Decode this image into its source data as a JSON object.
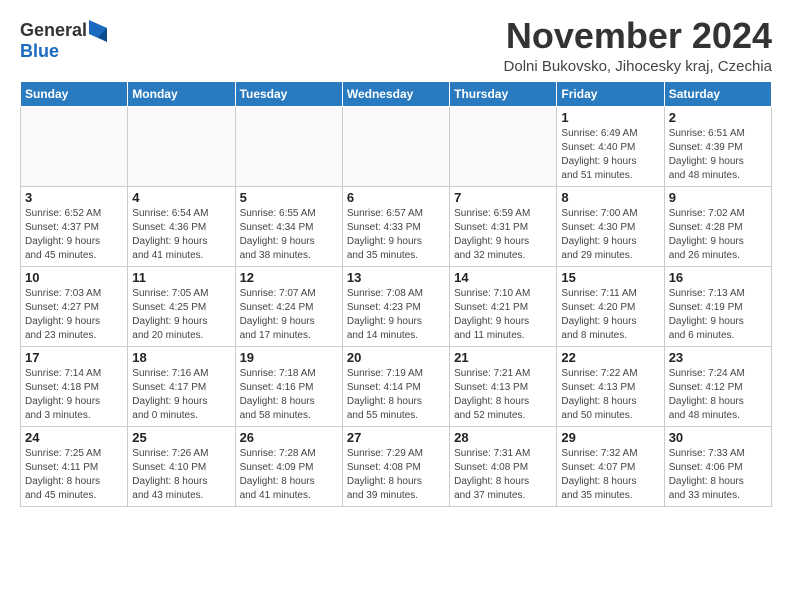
{
  "logo": {
    "general": "General",
    "blue": "Blue"
  },
  "title": "November 2024",
  "location": "Dolni Bukovsko, Jihocesky kraj, Czechia",
  "headers": [
    "Sunday",
    "Monday",
    "Tuesday",
    "Wednesday",
    "Thursday",
    "Friday",
    "Saturday"
  ],
  "weeks": [
    [
      {
        "day": "",
        "info": ""
      },
      {
        "day": "",
        "info": ""
      },
      {
        "day": "",
        "info": ""
      },
      {
        "day": "",
        "info": ""
      },
      {
        "day": "",
        "info": ""
      },
      {
        "day": "1",
        "info": "Sunrise: 6:49 AM\nSunset: 4:40 PM\nDaylight: 9 hours\nand 51 minutes."
      },
      {
        "day": "2",
        "info": "Sunrise: 6:51 AM\nSunset: 4:39 PM\nDaylight: 9 hours\nand 48 minutes."
      }
    ],
    [
      {
        "day": "3",
        "info": "Sunrise: 6:52 AM\nSunset: 4:37 PM\nDaylight: 9 hours\nand 45 minutes."
      },
      {
        "day": "4",
        "info": "Sunrise: 6:54 AM\nSunset: 4:36 PM\nDaylight: 9 hours\nand 41 minutes."
      },
      {
        "day": "5",
        "info": "Sunrise: 6:55 AM\nSunset: 4:34 PM\nDaylight: 9 hours\nand 38 minutes."
      },
      {
        "day": "6",
        "info": "Sunrise: 6:57 AM\nSunset: 4:33 PM\nDaylight: 9 hours\nand 35 minutes."
      },
      {
        "day": "7",
        "info": "Sunrise: 6:59 AM\nSunset: 4:31 PM\nDaylight: 9 hours\nand 32 minutes."
      },
      {
        "day": "8",
        "info": "Sunrise: 7:00 AM\nSunset: 4:30 PM\nDaylight: 9 hours\nand 29 minutes."
      },
      {
        "day": "9",
        "info": "Sunrise: 7:02 AM\nSunset: 4:28 PM\nDaylight: 9 hours\nand 26 minutes."
      }
    ],
    [
      {
        "day": "10",
        "info": "Sunrise: 7:03 AM\nSunset: 4:27 PM\nDaylight: 9 hours\nand 23 minutes."
      },
      {
        "day": "11",
        "info": "Sunrise: 7:05 AM\nSunset: 4:25 PM\nDaylight: 9 hours\nand 20 minutes."
      },
      {
        "day": "12",
        "info": "Sunrise: 7:07 AM\nSunset: 4:24 PM\nDaylight: 9 hours\nand 17 minutes."
      },
      {
        "day": "13",
        "info": "Sunrise: 7:08 AM\nSunset: 4:23 PM\nDaylight: 9 hours\nand 14 minutes."
      },
      {
        "day": "14",
        "info": "Sunrise: 7:10 AM\nSunset: 4:21 PM\nDaylight: 9 hours\nand 11 minutes."
      },
      {
        "day": "15",
        "info": "Sunrise: 7:11 AM\nSunset: 4:20 PM\nDaylight: 9 hours\nand 8 minutes."
      },
      {
        "day": "16",
        "info": "Sunrise: 7:13 AM\nSunset: 4:19 PM\nDaylight: 9 hours\nand 6 minutes."
      }
    ],
    [
      {
        "day": "17",
        "info": "Sunrise: 7:14 AM\nSunset: 4:18 PM\nDaylight: 9 hours\nand 3 minutes."
      },
      {
        "day": "18",
        "info": "Sunrise: 7:16 AM\nSunset: 4:17 PM\nDaylight: 9 hours\nand 0 minutes."
      },
      {
        "day": "19",
        "info": "Sunrise: 7:18 AM\nSunset: 4:16 PM\nDaylight: 8 hours\nand 58 minutes."
      },
      {
        "day": "20",
        "info": "Sunrise: 7:19 AM\nSunset: 4:14 PM\nDaylight: 8 hours\nand 55 minutes."
      },
      {
        "day": "21",
        "info": "Sunrise: 7:21 AM\nSunset: 4:13 PM\nDaylight: 8 hours\nand 52 minutes."
      },
      {
        "day": "22",
        "info": "Sunrise: 7:22 AM\nSunset: 4:13 PM\nDaylight: 8 hours\nand 50 minutes."
      },
      {
        "day": "23",
        "info": "Sunrise: 7:24 AM\nSunset: 4:12 PM\nDaylight: 8 hours\nand 48 minutes."
      }
    ],
    [
      {
        "day": "24",
        "info": "Sunrise: 7:25 AM\nSunset: 4:11 PM\nDaylight: 8 hours\nand 45 minutes."
      },
      {
        "day": "25",
        "info": "Sunrise: 7:26 AM\nSunset: 4:10 PM\nDaylight: 8 hours\nand 43 minutes."
      },
      {
        "day": "26",
        "info": "Sunrise: 7:28 AM\nSunset: 4:09 PM\nDaylight: 8 hours\nand 41 minutes."
      },
      {
        "day": "27",
        "info": "Sunrise: 7:29 AM\nSunset: 4:08 PM\nDaylight: 8 hours\nand 39 minutes."
      },
      {
        "day": "28",
        "info": "Sunrise: 7:31 AM\nSunset: 4:08 PM\nDaylight: 8 hours\nand 37 minutes."
      },
      {
        "day": "29",
        "info": "Sunrise: 7:32 AM\nSunset: 4:07 PM\nDaylight: 8 hours\nand 35 minutes."
      },
      {
        "day": "30",
        "info": "Sunrise: 7:33 AM\nSunset: 4:06 PM\nDaylight: 8 hours\nand 33 minutes."
      }
    ]
  ]
}
